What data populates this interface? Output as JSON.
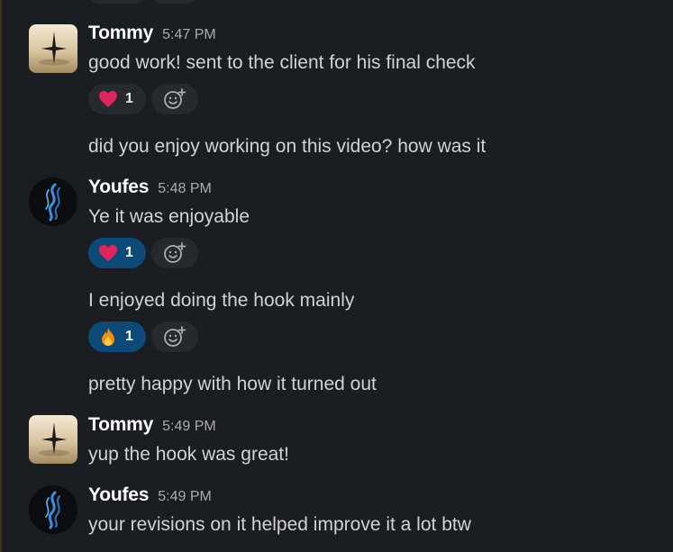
{
  "messages": [
    {
      "author": "Tommy",
      "time": "5:47 PM",
      "lines": [
        {
          "text": "good work! sent to the client for his final check",
          "reaction": {
            "emoji": "heart-emoji",
            "count": "1",
            "active": false
          }
        },
        {
          "text": "did you enjoy working on this video? how was it"
        }
      ]
    },
    {
      "author": "Youfes",
      "time": "5:48 PM",
      "lines": [
        {
          "text": "Ye it was enjoyable",
          "reaction": {
            "emoji": "heart-emoji",
            "count": "1",
            "active": true
          }
        },
        {
          "text": "I enjoyed doing the hook mainly",
          "reaction": {
            "emoji": "fire-emoji",
            "count": "1",
            "active": true
          }
        },
        {
          "text": "pretty happy with how it turned out"
        }
      ]
    },
    {
      "author": "Tommy",
      "time": "5:49 PM",
      "lines": [
        {
          "text": "yup the hook was great!"
        }
      ]
    },
    {
      "author": "Youfes",
      "time": "5:49 PM",
      "lines": [
        {
          "text": "your revisions on it helped improve it a lot btw"
        }
      ]
    }
  ],
  "colors": {
    "background": "#1a1d21",
    "text": "#d1d2d3",
    "author": "#ffffff",
    "timestamp": "#ababad",
    "reaction_pill": "#26292e",
    "reaction_active": "#0e4a78"
  }
}
